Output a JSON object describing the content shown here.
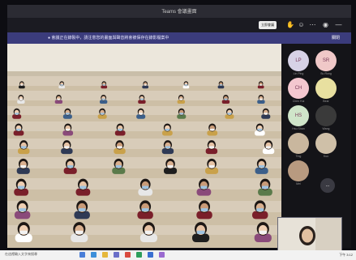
{
  "window": {
    "title": "Teams 會議畫面"
  },
  "toolbar": {
    "meet_label": "立即會議"
  },
  "notice": {
    "text": "● 會議正在錄製中，請注意您的畫面與聲音將會被保存在錄影檔案中",
    "dismiss": "關閉"
  },
  "attendees": [
    {
      "initials": "LP",
      "name": "Lin Ping",
      "color": "#d7d2e6"
    },
    {
      "initials": "SR",
      "name": "Su Rong",
      "color": "#f0c8c8"
    },
    {
      "initials": "CH",
      "name": "Chen Hui",
      "color": "#f4c7cf"
    },
    {
      "initials": "",
      "name": "Bear",
      "color": "#e8e0a0"
    },
    {
      "initials": "HS",
      "name": "Hsu Shan",
      "color": "#cfe5c9"
    },
    {
      "initials": "",
      "name": "Wang",
      "color": "#3a3a3a"
    },
    {
      "initials": "",
      "name": "Ting",
      "color": "#c9b79e"
    },
    {
      "initials": "",
      "name": "Kuo",
      "color": "#cfc0a8"
    },
    {
      "initials": "",
      "name": "Mei",
      "color": "#b89a80"
    }
  ],
  "more_label": "...",
  "taskbar": {
    "search": "在這裡輸入文字來搜尋",
    "clock": "下午 3:12"
  }
}
